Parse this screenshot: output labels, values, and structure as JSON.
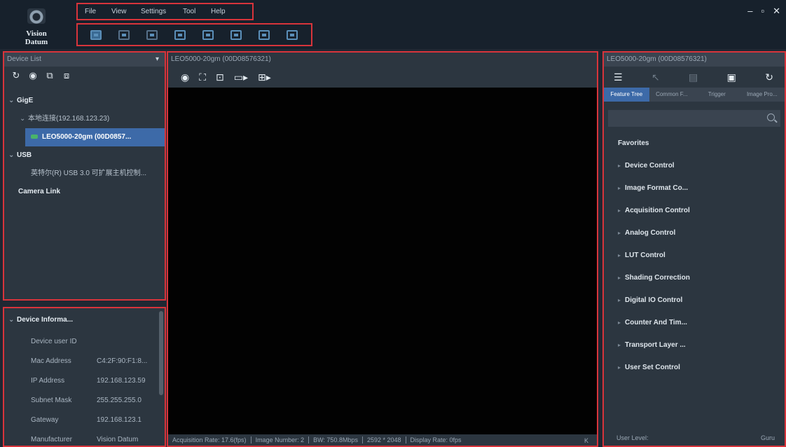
{
  "app": {
    "name": "Vision Datum"
  },
  "menu": [
    "File",
    "View",
    "Settings",
    "Tool",
    "Help"
  ],
  "toolbar_icons": [
    "open-folder-icon",
    "window-icon",
    "layers-icon",
    "export-icon",
    "image-icon",
    "display-icon",
    "layout-icon",
    "save-icon"
  ],
  "window_controls": {
    "minimize": "–",
    "maximize": "▫",
    "close": "✕"
  },
  "device_list": {
    "title": "Device List",
    "tree": {
      "gige": "GigE",
      "nic": "本地连接(192.168.123.23)",
      "camera": "LEO5000-20gm (00D0857...",
      "usb": "USB",
      "usb_device": "英特尔(R) USB 3.0 可扩展主机控制...",
      "camera_link": "Camera Link"
    }
  },
  "device_info": {
    "title": "Device Informa...",
    "rows": [
      {
        "key": "Device user ID",
        "value": ""
      },
      {
        "key": "Mac Address",
        "value": "C4:2F:90:F1:8..."
      },
      {
        "key": "IP Address",
        "value": "192.168.123.59"
      },
      {
        "key": "Subnet Mask",
        "value": "255.255.255.0"
      },
      {
        "key": "Gateway",
        "value": "192.168.123.1"
      },
      {
        "key": "Manufacturer",
        "value": "Vision Datum"
      }
    ]
  },
  "viewer": {
    "title": "LEO5000-20gm (00D08576321)",
    "status": {
      "acquisition": "Acquisition Rate: 17.6(fps)",
      "image_number": "Image Number: 2",
      "bandwidth": "BW: 750.8Mbps",
      "resolution": "2592 * 2048",
      "display_rate": "Display Rate: 0fps"
    }
  },
  "features": {
    "title": "LEO5000-20gm (00D08576321)",
    "tabs": [
      "Feature Tree",
      "Common F...",
      "Trigger",
      "Image Pro..."
    ],
    "favorites": "Favorites",
    "items": [
      "Device Control",
      "Image Format Co...",
      "Acquisition Control",
      "Analog Control",
      "LUT Control",
      "Shading Correction",
      "Digital IO Control",
      "Counter And Tim...",
      "Transport Layer ...",
      "User Set Control"
    ],
    "user_level_label": "User Level:",
    "user_level_value": "Guru"
  }
}
